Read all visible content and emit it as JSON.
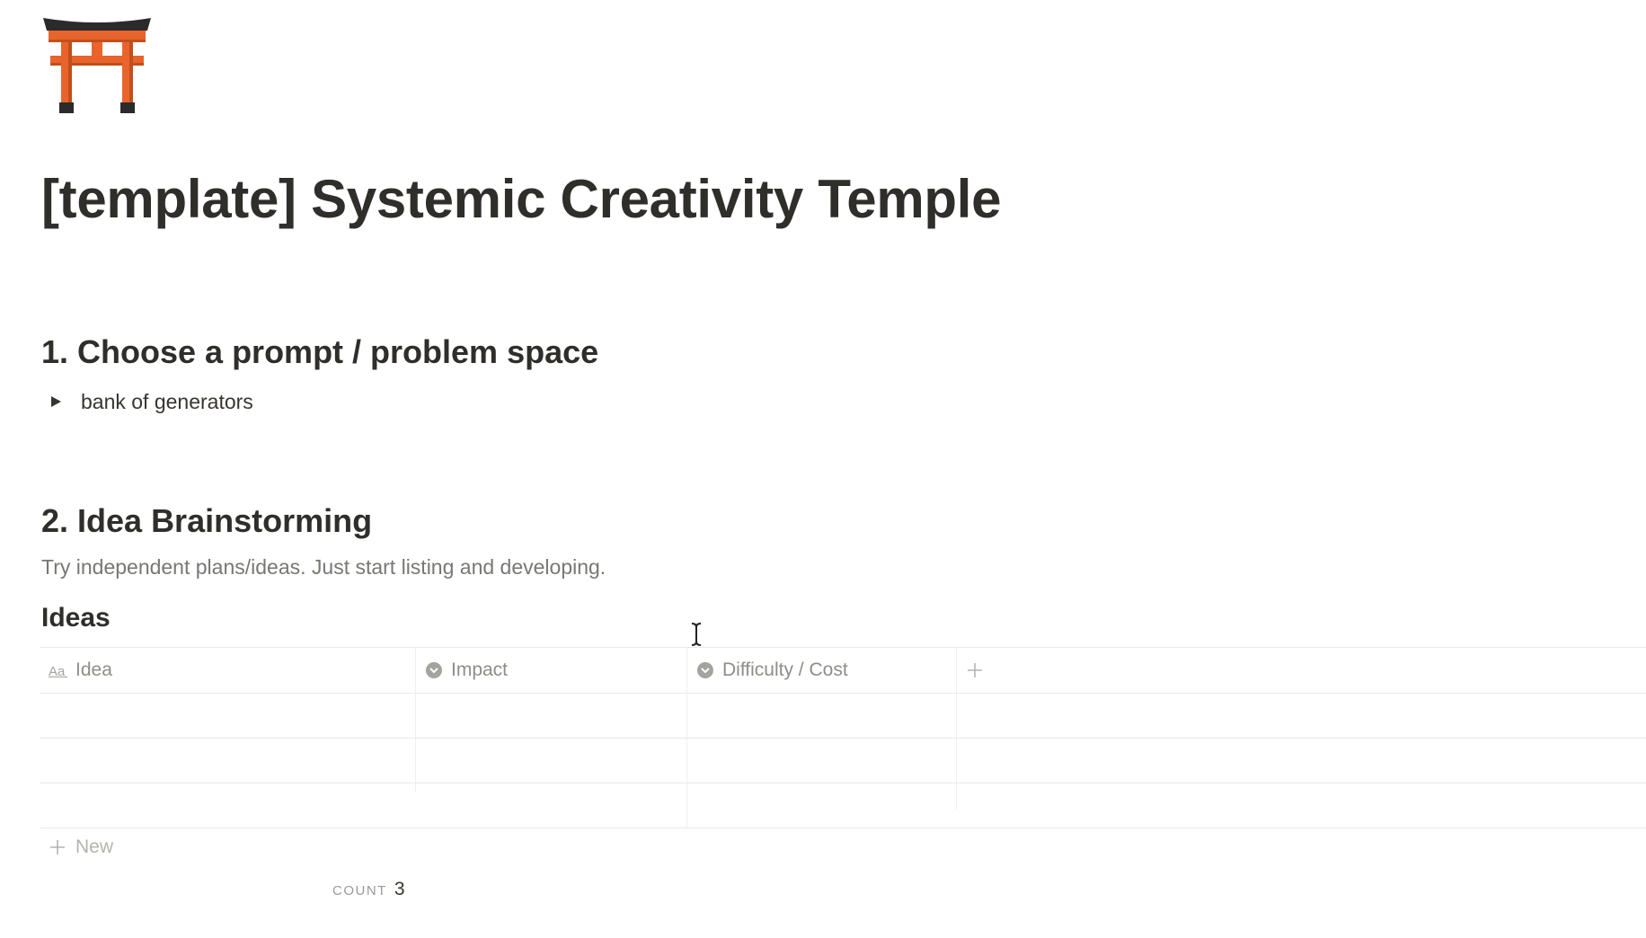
{
  "page": {
    "icon": "torii-gate-icon",
    "title": "[template] Systemic Creativity Temple"
  },
  "section1": {
    "heading": "1. Choose a prompt / problem space",
    "toggle_label": "bank of generators"
  },
  "section2": {
    "heading": "2. Idea Brainstorming",
    "description": "Try independent plans/ideas. Just start listing and developing."
  },
  "database": {
    "title": "Ideas",
    "columns": [
      {
        "label": "Idea",
        "icon": "title-aa-icon"
      },
      {
        "label": "Impact",
        "icon": "select-chevron-icon"
      },
      {
        "label": "Difficulty / Cost",
        "icon": "select-chevron-icon"
      }
    ],
    "add_column_icon": "plus-icon",
    "rows": [
      {
        "idea": "",
        "impact": "",
        "difficulty": ""
      },
      {
        "idea": "",
        "impact": "",
        "difficulty": ""
      },
      {
        "idea": "",
        "impact": "",
        "difficulty": ""
      }
    ],
    "new_label": "New",
    "count_label": "COUNT",
    "count_value": "3"
  },
  "colors": {
    "torii_red": "#e8642c",
    "torii_dark": "#2b2b2b",
    "text": "#37352f",
    "muted": "#787774",
    "divider": "#e9e9e7"
  }
}
